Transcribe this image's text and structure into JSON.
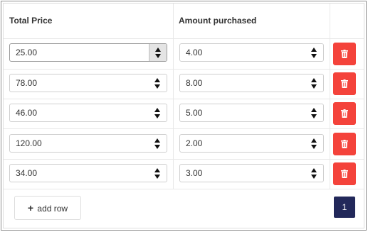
{
  "table": {
    "headers": [
      "Total Price",
      "Amount purchased",
      ""
    ],
    "rows": [
      {
        "total_price": "25.00",
        "amount": "4.00"
      },
      {
        "total_price": "78.00",
        "amount": "8.00"
      },
      {
        "total_price": "46.00",
        "amount": "5.00"
      },
      {
        "total_price": "120.00",
        "amount": "2.00"
      },
      {
        "total_price": "34.00",
        "amount": "3.00"
      }
    ],
    "delete_icon": "trash-icon"
  },
  "footer": {
    "add_row_label": "add row",
    "add_row_icon": "plus-icon",
    "pagination": {
      "current_page": "1"
    }
  },
  "colors": {
    "delete_button": "#f4433b",
    "pagination_active": "#22285a"
  }
}
